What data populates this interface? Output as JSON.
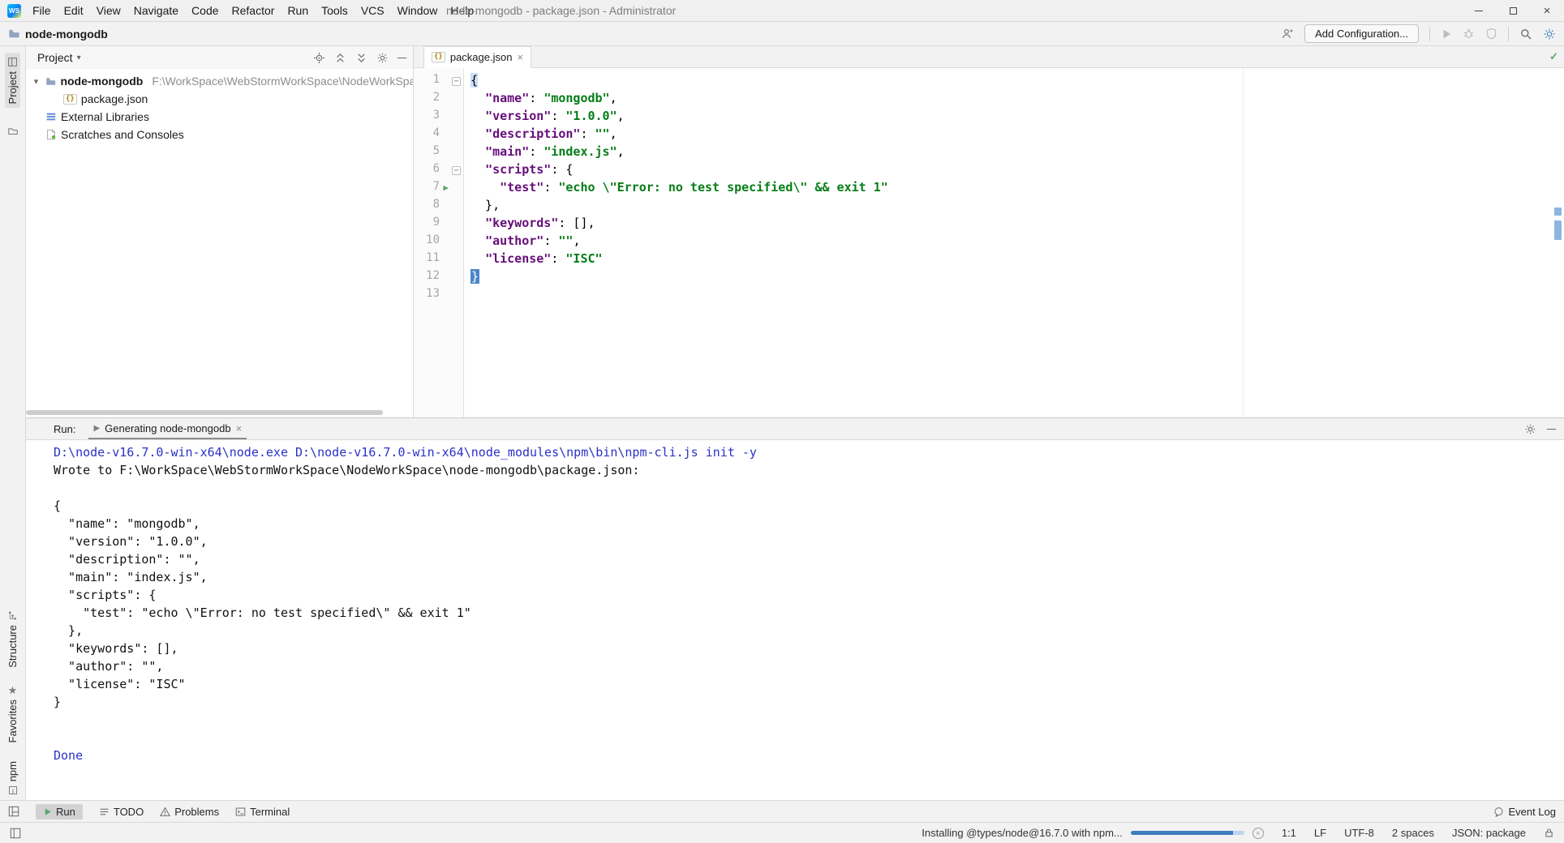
{
  "window": {
    "title": "node-mongodb - package.json - Administrator"
  },
  "menu_bar": [
    "File",
    "Edit",
    "View",
    "Navigate",
    "Code",
    "Refactor",
    "Run",
    "Tools",
    "VCS",
    "Window",
    "Help"
  ],
  "toolbar": {
    "breadcrumb": "node-mongodb",
    "add_configuration": "Add Configuration..."
  },
  "left_strip": {
    "project": "Project",
    "structure": "Structure",
    "favorites": "Favorites",
    "npm": "npm"
  },
  "project_panel": {
    "header": "Project",
    "tree": [
      {
        "name": "node-mongodb",
        "path": "F:\\WorkSpace\\WebStormWorkSpace\\NodeWorkSpace\\no"
      },
      {
        "name": "package.json"
      },
      {
        "name": "External Libraries"
      },
      {
        "name": "Scratches and Consoles"
      }
    ]
  },
  "editor": {
    "tab": "package.json",
    "lines": [
      {
        "n": 1,
        "fold": true,
        "t": [
          [
            "b1",
            "{"
          ]
        ]
      },
      {
        "n": 2,
        "t": [
          [
            "pl",
            "  "
          ],
          [
            "key",
            "\"name\""
          ],
          [
            "pl",
            ": "
          ],
          [
            "str",
            "\"mongodb\""
          ],
          [
            "pl",
            ","
          ]
        ]
      },
      {
        "n": 3,
        "t": [
          [
            "pl",
            "  "
          ],
          [
            "key",
            "\"version\""
          ],
          [
            "pl",
            ": "
          ],
          [
            "str",
            "\"1.0.0\""
          ],
          [
            "pl",
            ","
          ]
        ]
      },
      {
        "n": 4,
        "t": [
          [
            "pl",
            "  "
          ],
          [
            "key",
            "\"description\""
          ],
          [
            "pl",
            ": "
          ],
          [
            "str",
            "\"\""
          ],
          [
            "pl",
            ","
          ]
        ]
      },
      {
        "n": 5,
        "t": [
          [
            "pl",
            "  "
          ],
          [
            "key",
            "\"main\""
          ],
          [
            "pl",
            ": "
          ],
          [
            "str",
            "\"index.js\""
          ],
          [
            "pl",
            ","
          ]
        ]
      },
      {
        "n": 6,
        "fold": true,
        "t": [
          [
            "pl",
            "  "
          ],
          [
            "key",
            "\"scripts\""
          ],
          [
            "pl",
            ": {"
          ]
        ]
      },
      {
        "n": 7,
        "run": true,
        "t": [
          [
            "pl",
            "    "
          ],
          [
            "key",
            "\"test\""
          ],
          [
            "pl",
            ": "
          ],
          [
            "str",
            "\"echo \\\"Error: no test specified\\\" && exit 1\""
          ]
        ]
      },
      {
        "n": 8,
        "t": [
          [
            "pl",
            "  },"
          ]
        ]
      },
      {
        "n": 9,
        "t": [
          [
            "pl",
            "  "
          ],
          [
            "key",
            "\"keywords\""
          ],
          [
            "pl",
            ": [],"
          ]
        ]
      },
      {
        "n": 10,
        "t": [
          [
            "pl",
            "  "
          ],
          [
            "key",
            "\"author\""
          ],
          [
            "pl",
            ": "
          ],
          [
            "str",
            "\"\""
          ],
          [
            "pl",
            ","
          ]
        ]
      },
      {
        "n": 11,
        "t": [
          [
            "pl",
            "  "
          ],
          [
            "key",
            "\"license\""
          ],
          [
            "pl",
            ": "
          ],
          [
            "str",
            "\"ISC\""
          ]
        ]
      },
      {
        "n": 12,
        "t": [
          [
            "b2",
            "}"
          ]
        ]
      },
      {
        "n": 13,
        "t": []
      }
    ]
  },
  "run_panel": {
    "label": "Run:",
    "tab": "Generating node-mongodb",
    "console": [
      [
        "cmd",
        "D:\\node-v16.7.0-win-x64\\node.exe D:\\node-v16.7.0-win-x64\\node_modules\\npm\\bin\\npm-cli.js init -y"
      ],
      [
        "out",
        "Wrote to F:\\WorkSpace\\WebStormWorkSpace\\NodeWorkSpace\\node-mongodb\\package.json:"
      ],
      [
        "out",
        ""
      ],
      [
        "out",
        "{"
      ],
      [
        "out",
        "  \"name\": \"mongodb\","
      ],
      [
        "out",
        "  \"version\": \"1.0.0\","
      ],
      [
        "out",
        "  \"description\": \"\","
      ],
      [
        "out",
        "  \"main\": \"index.js\","
      ],
      [
        "out",
        "  \"scripts\": {"
      ],
      [
        "out",
        "    \"test\": \"echo \\\"Error: no test specified\\\" && exit 1\""
      ],
      [
        "out",
        "  },"
      ],
      [
        "out",
        "  \"keywords\": [],"
      ],
      [
        "out",
        "  \"author\": \"\","
      ],
      [
        "out",
        "  \"license\": \"ISC\""
      ],
      [
        "out",
        "}"
      ],
      [
        "out",
        ""
      ],
      [
        "out",
        ""
      ],
      [
        "cmd",
        "Done"
      ]
    ]
  },
  "bottom_bar": {
    "items": [
      "Run",
      "TODO",
      "Problems",
      "Terminal"
    ],
    "event_log": "Event Log"
  },
  "status_bar": {
    "progress_text": "Installing @types/node@16.7.0 with npm...",
    "caret": "1:1",
    "line_ending": "LF",
    "encoding": "UTF-8",
    "indent": "2 spaces",
    "file_type": "JSON: package"
  },
  "colors": {
    "accent_blue": "#3e7cc0",
    "run_green": "#59a869",
    "json_key": "#660e7a",
    "json_string": "#067d17",
    "console_command": "#2a32c8",
    "check_green": "#59a869"
  }
}
